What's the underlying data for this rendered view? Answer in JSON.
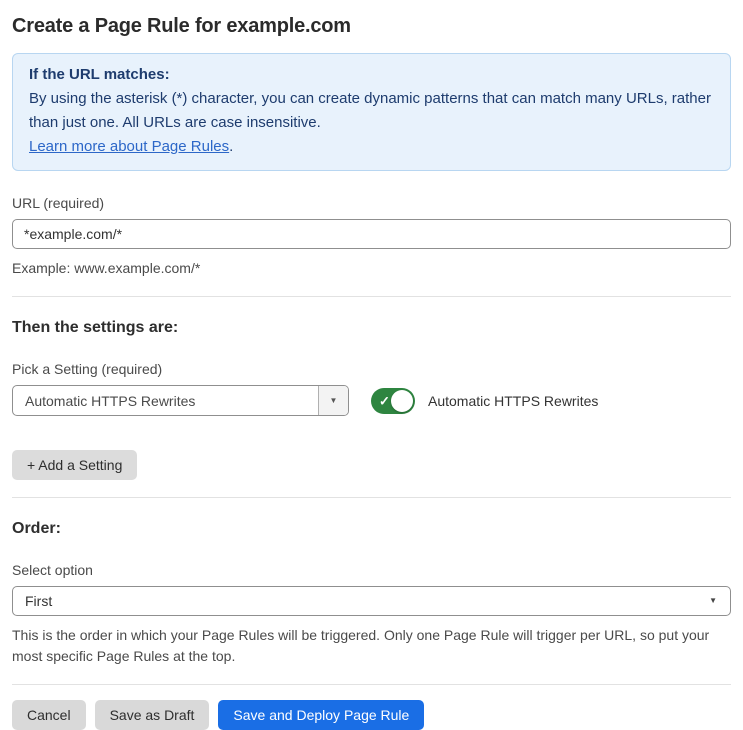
{
  "page": {
    "title": "Create a Page Rule for example.com"
  },
  "info_box": {
    "heading": "If the URL matches:",
    "body": "By using the asterisk (*) character, you can create dynamic patterns that can match many URLs, rather than just one. All URLs are case insensitive.",
    "link_text": "Learn more about Page Rules",
    "link_suffix": "."
  },
  "url_field": {
    "label": "URL (required)",
    "value": "*example.com/*",
    "helper": "Example: www.example.com/*"
  },
  "settings": {
    "heading": "Then the settings are:",
    "picker_label": "Pick a Setting (required)",
    "selected_setting": "Automatic HTTPS Rewrites",
    "toggle_label": "Automatic HTTPS Rewrites",
    "toggle_state": "on",
    "add_button_label": "+ Add a Setting"
  },
  "order": {
    "heading": "Order:",
    "label": "Select option",
    "selected_option": "First",
    "helper": "This is the order in which your Page Rules will be triggered. Only one Page Rule will trigger per URL, so put your most specific Page Rules at the top."
  },
  "footer": {
    "cancel_label": "Cancel",
    "save_draft_label": "Save as Draft",
    "save_deploy_label": "Save and Deploy Page Rule"
  },
  "icons": {
    "dropdown_arrow": "▼",
    "toggle_check": "✓"
  },
  "colors": {
    "accent_blue": "#1a6ee5",
    "info_box_bg": "#e8f2fc",
    "info_box_border": "#b8d6f1",
    "info_text": "#1e3c6e",
    "link_blue": "#2c67c8",
    "toggle_green": "#2e8540",
    "gray_button_bg": "#d9d9d9"
  }
}
